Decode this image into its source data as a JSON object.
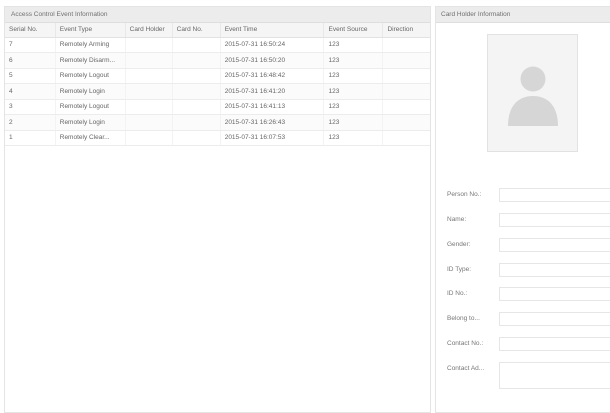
{
  "event_panel": {
    "title": "Access Control Event Information",
    "columns": [
      "Serial No.",
      "Event Type",
      "Card Holder",
      "Card No.",
      "Event Time",
      "Event Source",
      "Direction"
    ],
    "rows": [
      {
        "serial": "7",
        "event_type": "Remotely Arming",
        "card_holder": "",
        "card_no": "",
        "event_time": "2015-07-31 16:50:24",
        "event_source": "123",
        "direction": ""
      },
      {
        "serial": "6",
        "event_type": "Remotely Disarm...",
        "card_holder": "",
        "card_no": "",
        "event_time": "2015-07-31 16:50:20",
        "event_source": "123",
        "direction": ""
      },
      {
        "serial": "5",
        "event_type": "Remotely Logout",
        "card_holder": "",
        "card_no": "",
        "event_time": "2015-07-31 16:48:42",
        "event_source": "123",
        "direction": ""
      },
      {
        "serial": "4",
        "event_type": "Remotely Login",
        "card_holder": "",
        "card_no": "",
        "event_time": "2015-07-31 16:41:20",
        "event_source": "123",
        "direction": ""
      },
      {
        "serial": "3",
        "event_type": "Remotely Logout",
        "card_holder": "",
        "card_no": "",
        "event_time": "2015-07-31 16:41:13",
        "event_source": "123",
        "direction": ""
      },
      {
        "serial": "2",
        "event_type": "Remotely Login",
        "card_holder": "",
        "card_no": "",
        "event_time": "2015-07-31 16:26:43",
        "event_source": "123",
        "direction": ""
      },
      {
        "serial": "1",
        "event_type": "Remotely Clear...",
        "card_holder": "",
        "card_no": "",
        "event_time": "2015-07-31 16:07:53",
        "event_source": "123",
        "direction": ""
      }
    ]
  },
  "card_holder_panel": {
    "title": "Card Holder Information",
    "photo_icon": "person-silhouette-icon",
    "fields": [
      {
        "label": "Person No.:",
        "value": ""
      },
      {
        "label": "Name:",
        "value": ""
      },
      {
        "label": "Gender:",
        "value": ""
      },
      {
        "label": "ID Type:",
        "value": ""
      },
      {
        "label": "ID No.:",
        "value": ""
      },
      {
        "label": "Belong to...",
        "value": ""
      },
      {
        "label": "Contact No.:",
        "value": ""
      },
      {
        "label": "Contact Ad...",
        "value": ""
      }
    ]
  }
}
